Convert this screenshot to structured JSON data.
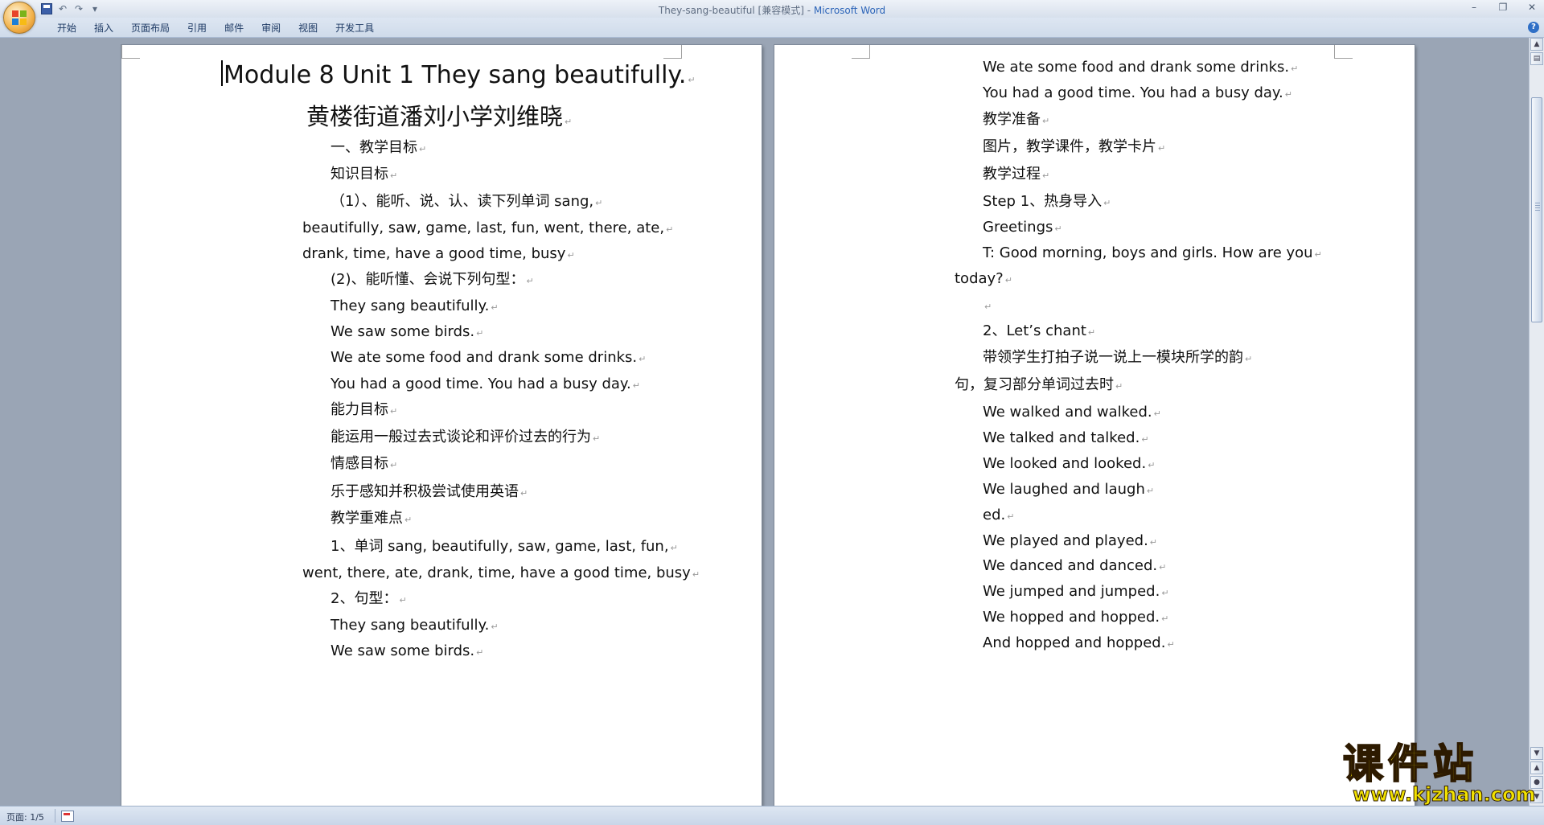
{
  "window": {
    "title_doc": "They-sang-beautiful [兼容模式] - ",
    "title_app": "Microsoft Word"
  },
  "quick_access": {
    "undo_label": "↶",
    "redo_label": "↷",
    "more_label": "▾"
  },
  "window_controls": {
    "minimize": "–",
    "restore": "❐",
    "close": "✕"
  },
  "ribbon": {
    "tabs": [
      "开始",
      "插入",
      "页面布局",
      "引用",
      "邮件",
      "审阅",
      "视图",
      "开发工具"
    ],
    "help_label": "?"
  },
  "document": {
    "left_page": [
      "Module 8 Unit 1 They sang beautifully.",
      "黄楼街道潘刘小学刘维晓",
      "一、教学目标",
      "知识目标",
      "（1）、能听、说、认、读下列单词 sang,",
      "beautifully, saw, game, last, fun, went, there, ate,",
      "drank, time, have a good time, busy",
      "(2)、能听懂、会说下列句型：",
      "They sang beautifully.",
      "We saw some birds.",
      "We ate some food and drank some drinks.",
      "You had a good time. You had a busy day.",
      "能力目标",
      "能运用一般过去式谈论和评价过去的行为",
      " 情感目标",
      "乐于感知并积极尝试使用英语",
      "教学重难点",
      "1、单词 sang, beautifully, saw, game, last, fun,",
      "went, there, ate, drank, time, have a good time, busy",
      "2、句型：",
      "They sang beautifully.",
      "We saw some birds."
    ],
    "right_page": [
      "We ate some food and drank some drinks.",
      "You had a good time. You had a busy day.",
      "教学准备",
      "图片，教学课件，教学卡片",
      "教学过程",
      "Step 1、热身导入",
      "Greetings",
      "T: Good morning, boys and girls. How are you",
      "today?",
      "",
      "2、Let’s chant",
      "带领学生打拍子说一说上一模块所学的韵",
      "句，复习部分单词过去时",
      "We walked and walked.",
      "We talked and talked.",
      "We looked and looked.",
      "We laughed and laugh",
      "ed.",
      "We played and played.",
      "We danced and danced.",
      "We jumped and jumped.",
      "We hopped and hopped.",
      "And hopped and hopped."
    ],
    "paragraph_mark": "↵"
  },
  "statusbar": {
    "page_label": "页面: 1/5"
  },
  "watermark": {
    "chinese": "课件站",
    "url": "www.kjzhan.com"
  }
}
